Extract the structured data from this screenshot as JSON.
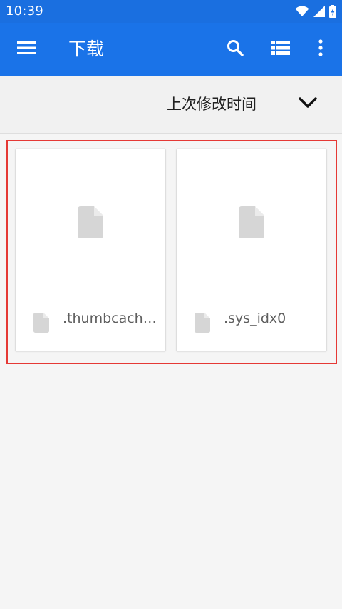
{
  "status_bar": {
    "time": "10:39",
    "icons": [
      "wifi-icon",
      "signal-icon",
      "battery-icon"
    ]
  },
  "app_bar": {
    "title": "下载",
    "icons": [
      "menu-icon",
      "search-icon",
      "list-view-icon",
      "more-vert-icon"
    ]
  },
  "sort_bar": {
    "label": "上次修改时间",
    "icon": "chevron-down-icon"
  },
  "files": [
    {
      "name": ".thumbcach…",
      "icon": "file-icon"
    },
    {
      "name": ".sys_idx0",
      "icon": "file-icon"
    }
  ],
  "colors": {
    "app_bar": "#1a73e8",
    "status_bar": "#1a6fe0",
    "selection_outline": "#e53935",
    "file_icon": "#d6d6d6"
  }
}
